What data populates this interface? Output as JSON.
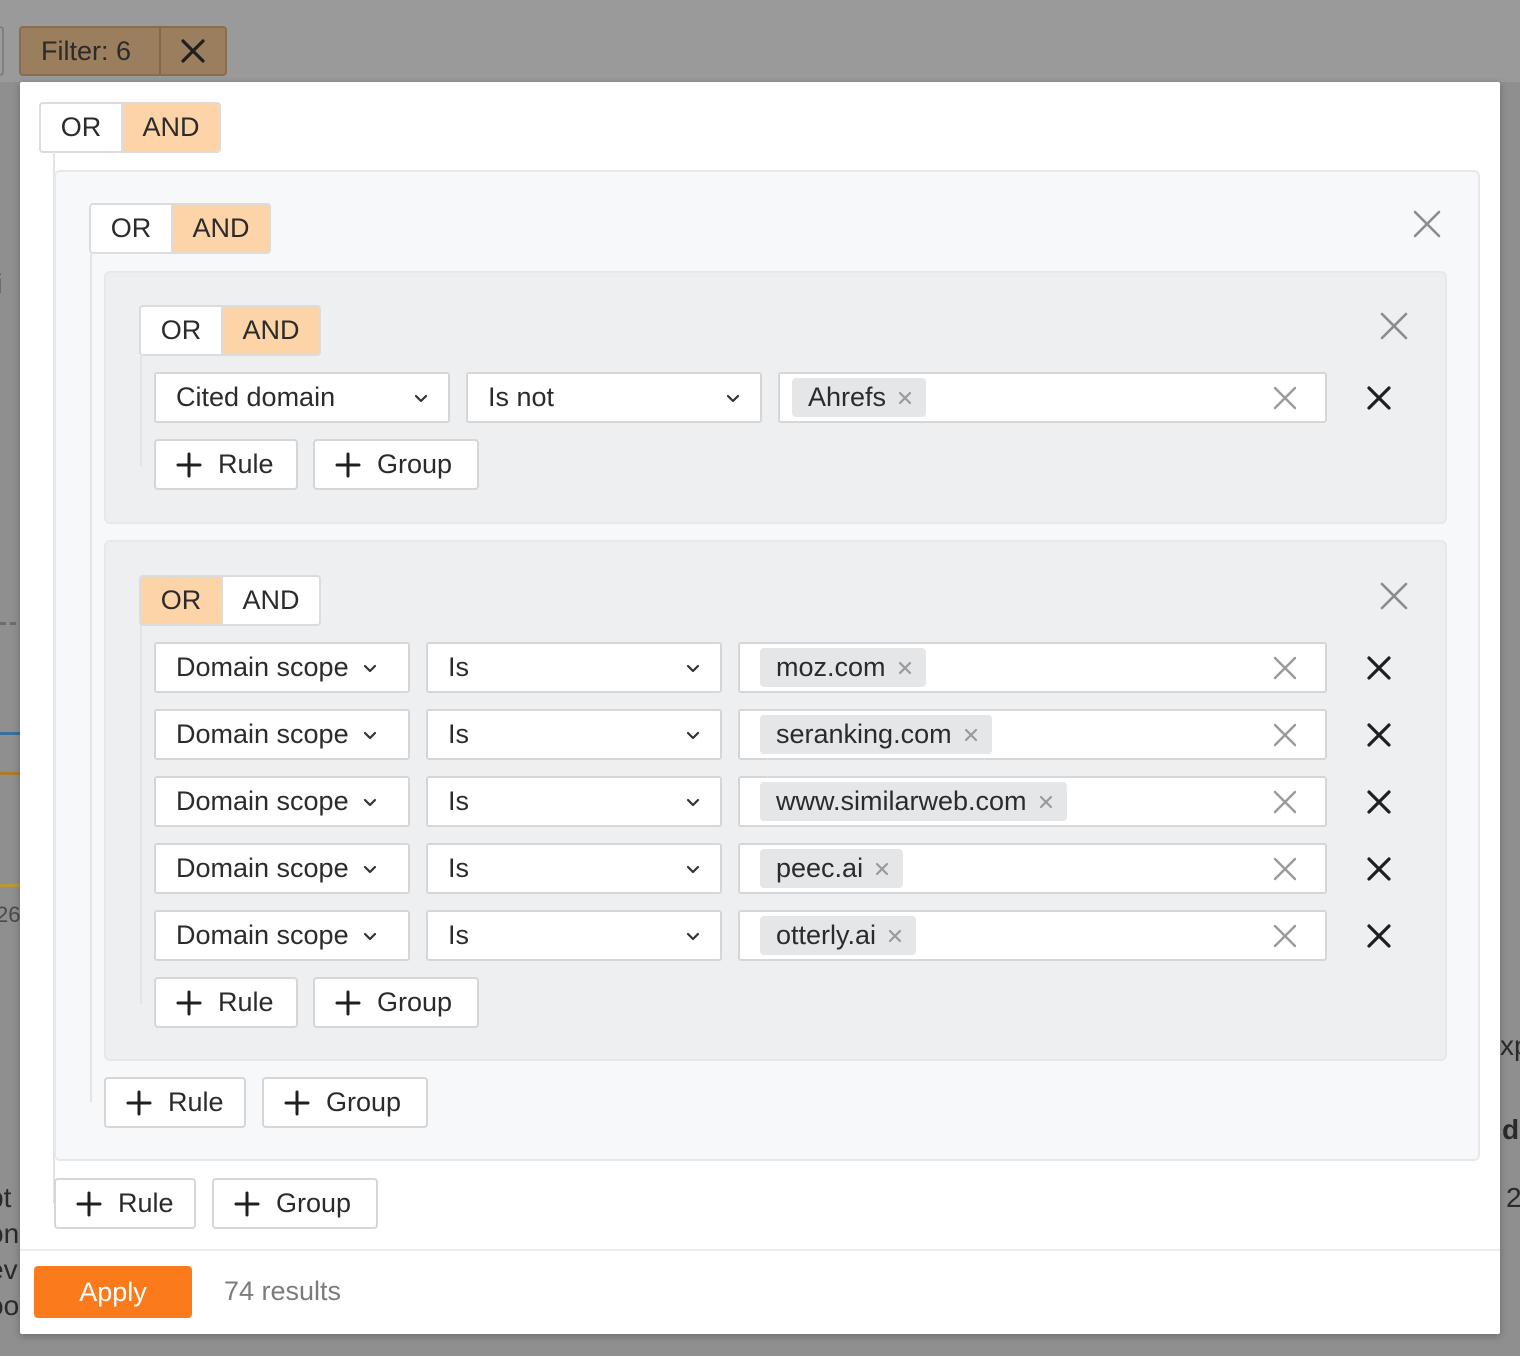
{
  "background": {
    "filter_chip_label": "Filter: 6",
    "left_fragments": [
      "i",
      "26",
      "pt",
      "on",
      "ev",
      "oo"
    ],
    "right_fragments": [
      "xp",
      "d",
      "2"
    ]
  },
  "root": {
    "mode": {
      "or_label": "OR",
      "and_label": "AND",
      "active": "AND"
    },
    "add_rule_label": "Rule",
    "add_group_label": "Group"
  },
  "group1": {
    "mode": {
      "or_label": "OR",
      "and_label": "AND",
      "active": "AND"
    },
    "add_rule_label": "Rule",
    "add_group_label": "Group",
    "group1a": {
      "mode": {
        "or_label": "OR",
        "and_label": "AND",
        "active": "AND"
      },
      "rules": [
        {
          "field": "Cited domain",
          "operator": "Is not",
          "value": "Ahrefs"
        }
      ],
      "add_rule_label": "Rule",
      "add_group_label": "Group"
    },
    "group1b": {
      "mode": {
        "or_label": "OR",
        "and_label": "AND",
        "active": "OR"
      },
      "rules": [
        {
          "field": "Domain scope",
          "operator": "Is",
          "value": "moz.com"
        },
        {
          "field": "Domain scope",
          "operator": "Is",
          "value": "seranking.com"
        },
        {
          "field": "Domain scope",
          "operator": "Is",
          "value": "www.similarweb.com"
        },
        {
          "field": "Domain scope",
          "operator": "Is",
          "value": "peec.ai"
        },
        {
          "field": "Domain scope",
          "operator": "Is",
          "value": "otterly.ai"
        }
      ],
      "add_rule_label": "Rule",
      "add_group_label": "Group"
    }
  },
  "footer": {
    "apply_label": "Apply",
    "results_text": "74 results"
  },
  "colors": {
    "accent": "#fb7a1c",
    "toggle_active": "#fdd3a8",
    "tag_bg": "#e5e6e8"
  }
}
